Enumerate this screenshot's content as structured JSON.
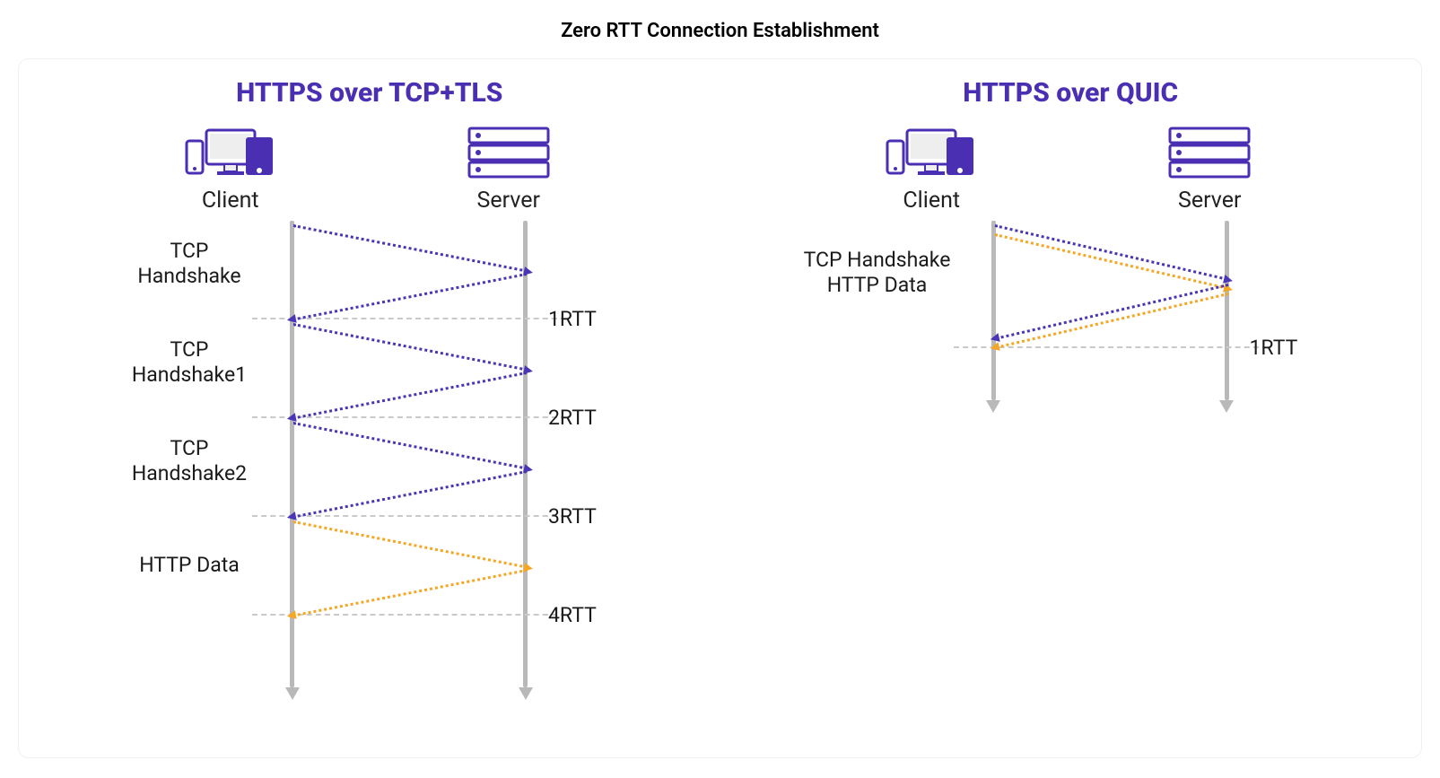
{
  "title": "Zero RTT Connection Establishment",
  "left": {
    "heading": "HTTPS over TCP+TLS",
    "client_label": "Client",
    "server_label": "Server",
    "phases": [
      {
        "label_line1": "TCP",
        "label_line2": "Handshake"
      },
      {
        "label_line1": "TCP",
        "label_line2": "Handshake1"
      },
      {
        "label_line1": "TCP",
        "label_line2": "Handshake2"
      },
      {
        "label_single": "HTTP Data"
      }
    ],
    "rtts": [
      "1RTT",
      "2RTT",
      "3RTT",
      "4RTT"
    ]
  },
  "right": {
    "heading": "HTTPS over QUIC",
    "client_label": "Client",
    "server_label": "Server",
    "phase_line1": "TCP Handshake",
    "phase_line2": "HTTP Data",
    "rtts": [
      "1RTT"
    ]
  },
  "colors": {
    "heading": "#4b2fb3",
    "purpleLine": "#4a35b5",
    "orangeLine": "#f5a623",
    "lifeline": "#b9b9b9"
  }
}
